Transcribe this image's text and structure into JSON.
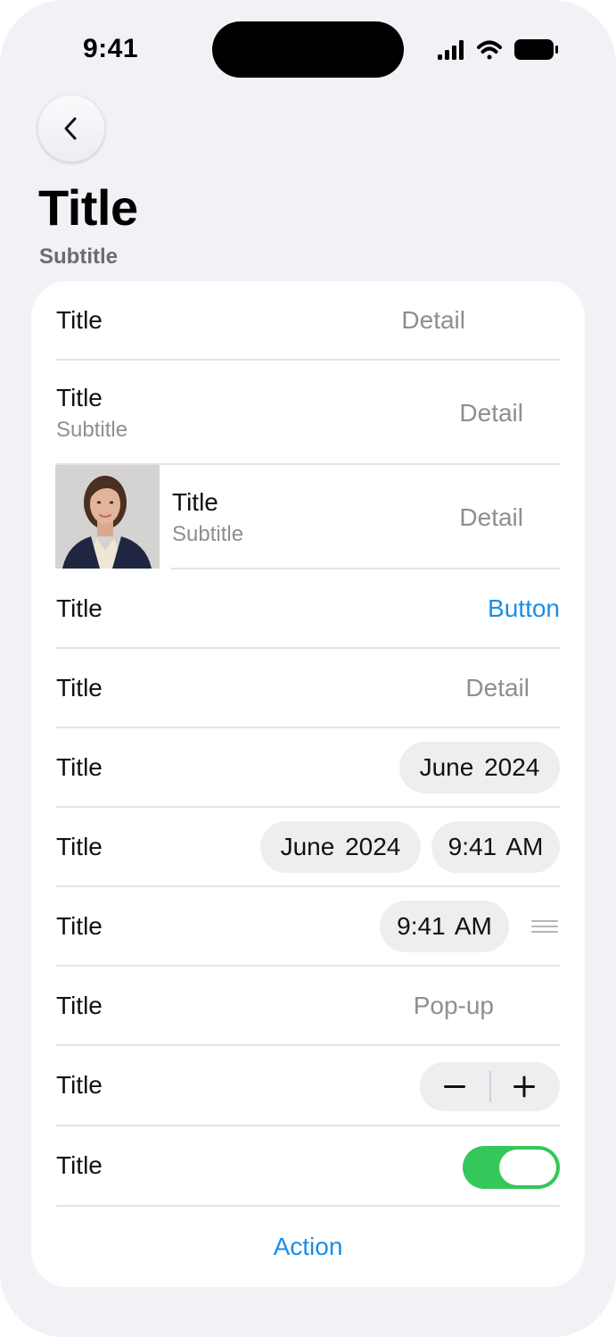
{
  "status_bar": {
    "time": "9:41"
  },
  "nav": {
    "back_icon": "chevron-left-icon",
    "title": "Title",
    "subtitle": "Subtitle"
  },
  "rows": [
    {
      "title": "Title",
      "detail": "Detail"
    },
    {
      "title": "Title",
      "subtitle": "Subtitle",
      "detail": "Detail"
    },
    {
      "title": "Title",
      "subtitle": "Subtitle",
      "detail": "Detail",
      "image": "portrait-photo"
    },
    {
      "title": "Title",
      "button": "Button"
    },
    {
      "title": "Title",
      "detail": "Detail"
    },
    {
      "title": "Title",
      "date": "June 2024"
    },
    {
      "title": "Title",
      "date": "June 2024",
      "time": "9:41 AM"
    },
    {
      "title": "Title",
      "time": "9:41 AM",
      "handle_icon": "drag-handle-icon"
    },
    {
      "title": "Title",
      "popup": "Pop-up"
    },
    {
      "title": "Title",
      "stepper_minus": "minus-icon",
      "stepper_plus": "plus-icon"
    },
    {
      "title": "Title",
      "toggle_on": true
    }
  ],
  "action": "Action",
  "colors": {
    "accent": "#1a8ee8",
    "toggle_on": "#34c759",
    "background": "#f1f1f6"
  }
}
